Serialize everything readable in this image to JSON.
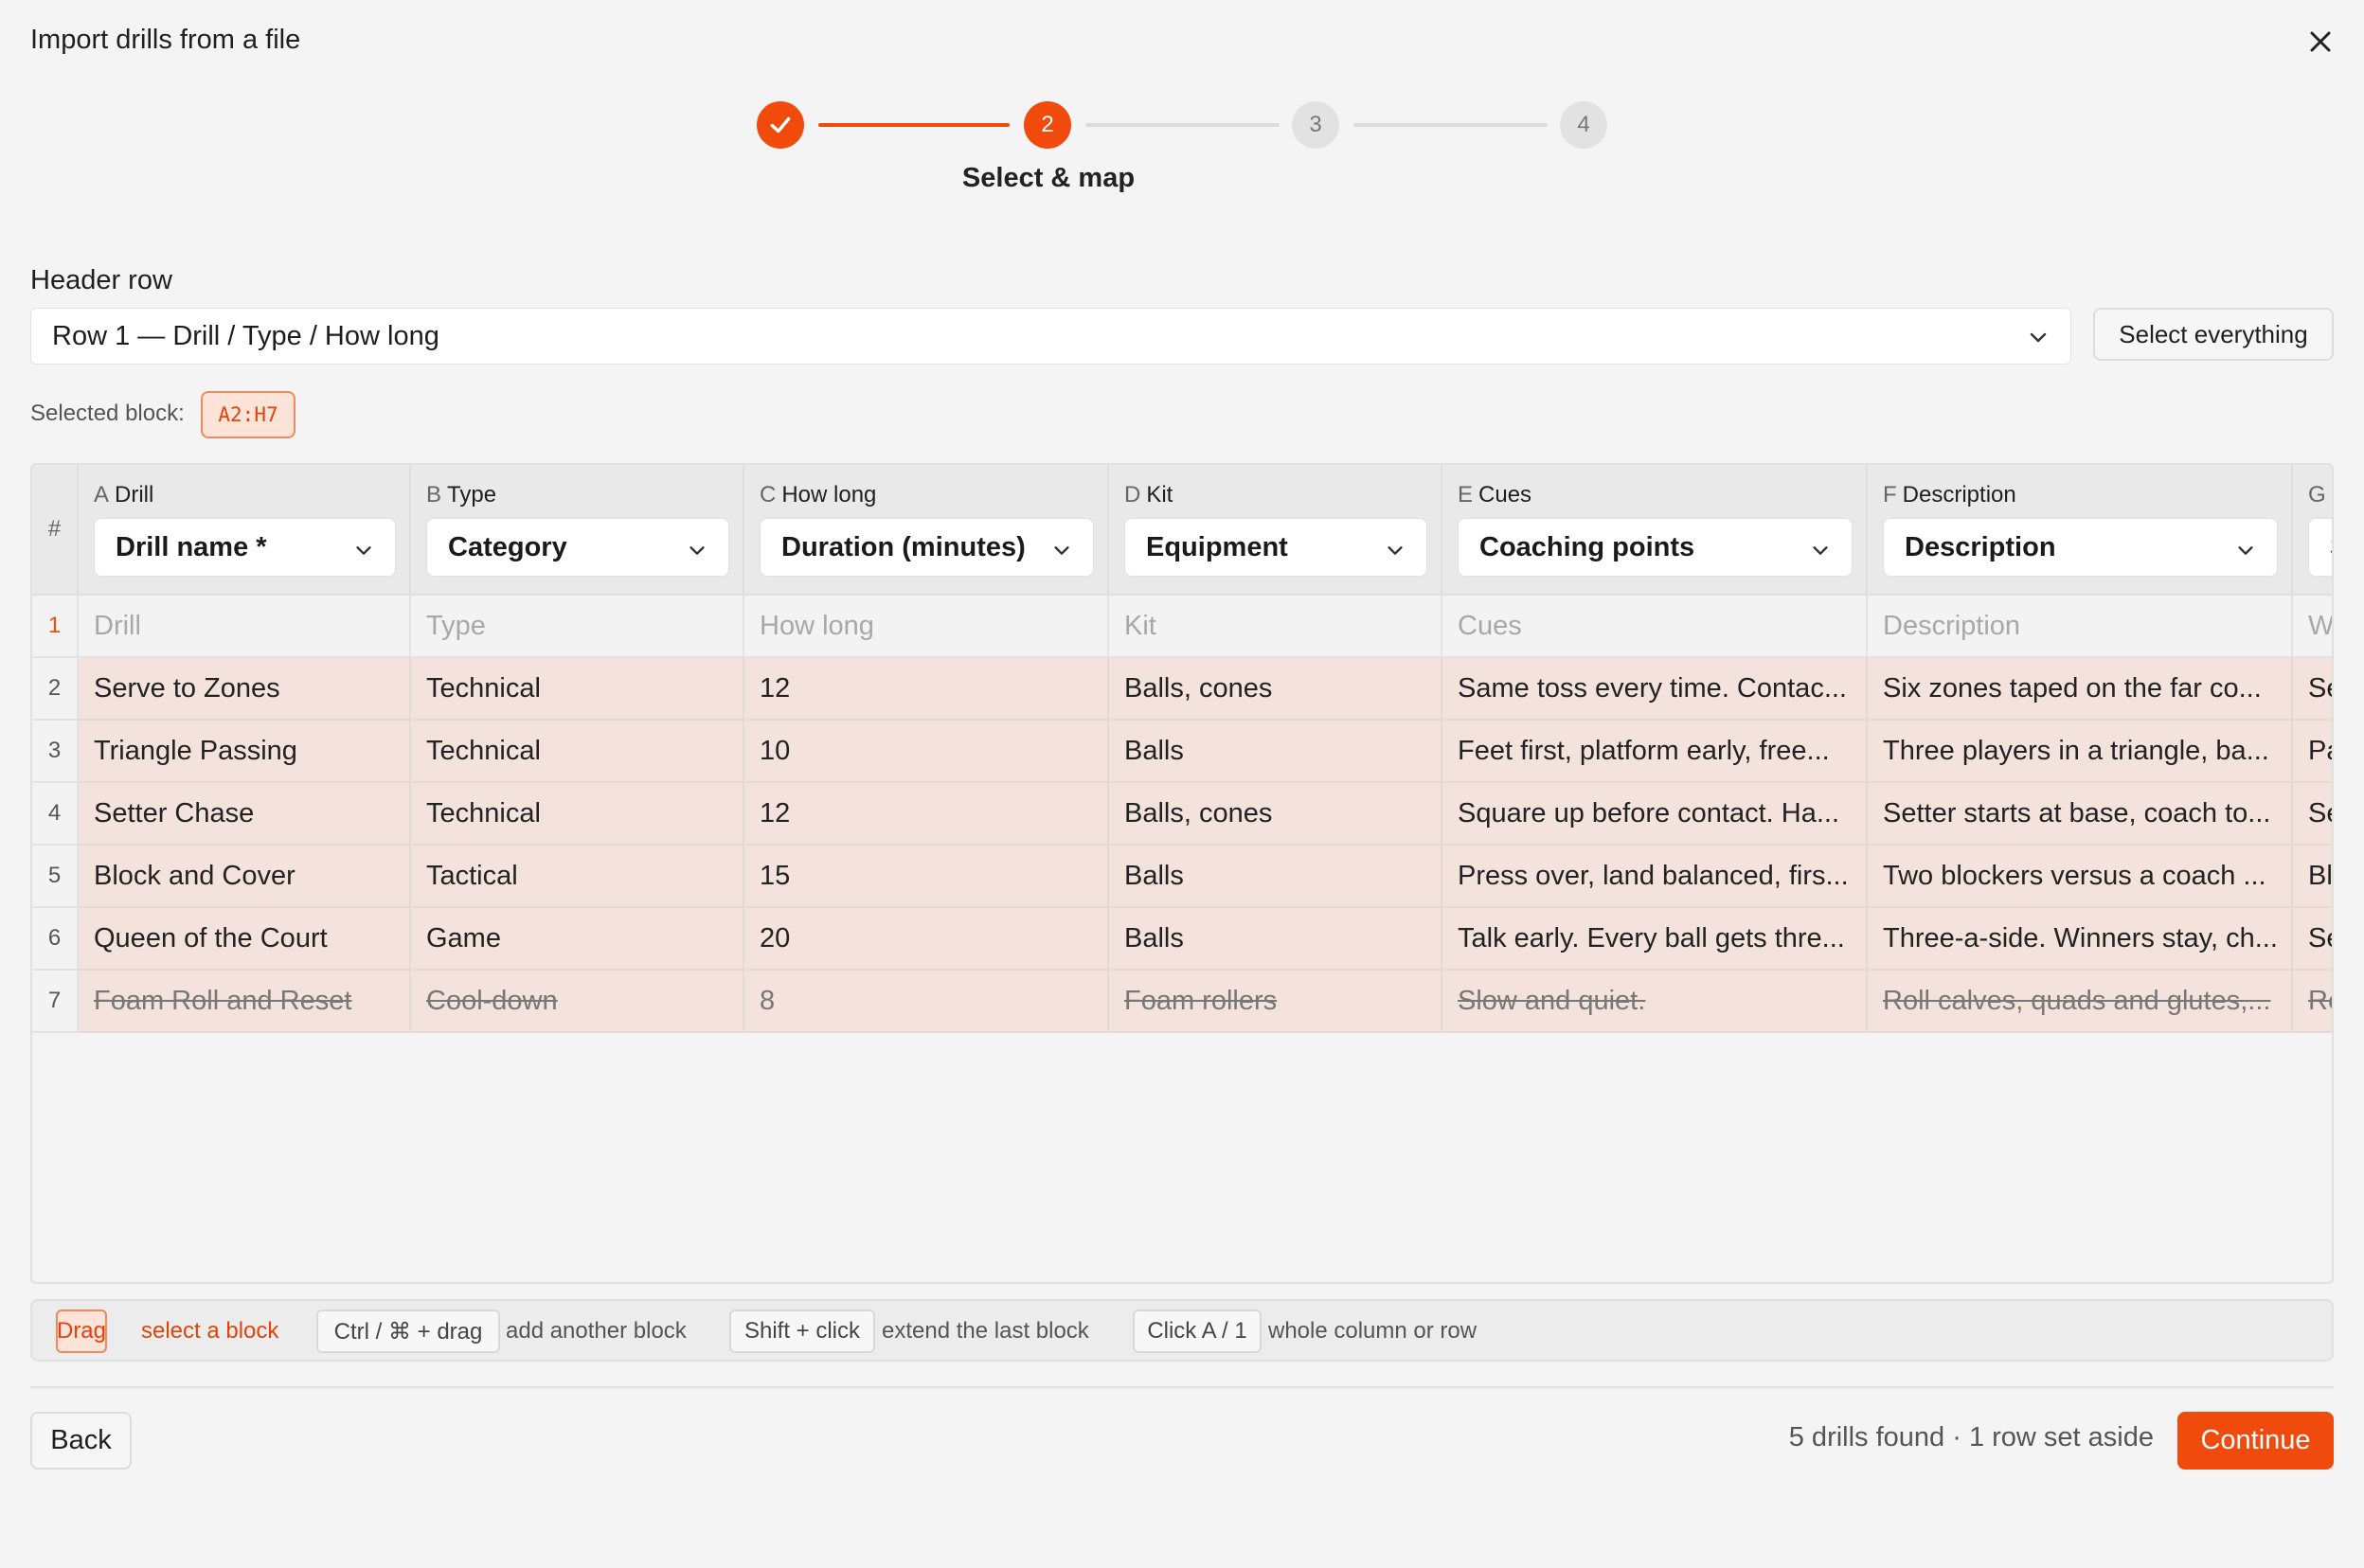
{
  "dialog": {
    "title": "Import drills from a file"
  },
  "stepper": {
    "steps": [
      "",
      "2",
      "3",
      "4"
    ],
    "current_label": "Select & map"
  },
  "header_row": {
    "label": "Header row",
    "value": "Row 1 — Drill / Type / How long",
    "select_all_label": "Select everything"
  },
  "selection": {
    "label": "Selected block:",
    "range": "A2:H7"
  },
  "grid": {
    "hash": "#",
    "columns": [
      {
        "letter": "A",
        "name": "Drill",
        "mapping": "Drill name *"
      },
      {
        "letter": "B",
        "name": "Type",
        "mapping": "Category"
      },
      {
        "letter": "C",
        "name": "How long",
        "mapping": "Duration (minutes)"
      },
      {
        "letter": "D",
        "name": "Kit",
        "mapping": "Equipment"
      },
      {
        "letter": "E",
        "name": "Cues",
        "mapping": "Coaching points"
      },
      {
        "letter": "F",
        "name": "Description",
        "mapping": "Description"
      },
      {
        "letter": "G",
        "name": "",
        "mapping": "S"
      }
    ],
    "rows": [
      {
        "num": "1",
        "cells": [
          "Drill",
          "Type",
          "How long",
          "Kit",
          "Cues",
          "Description",
          "W"
        ]
      },
      {
        "num": "2",
        "cells": [
          "Serve to Zones",
          "Technical",
          "12",
          "Balls, cones",
          "Same toss every time. Contac...",
          "Six zones taped on the far co...",
          "Se"
        ]
      },
      {
        "num": "3",
        "cells": [
          "Triangle Passing",
          "Technical",
          "10",
          "Balls",
          "Feet first, platform early, free...",
          "Three players in a triangle, ba...",
          "Pa"
        ]
      },
      {
        "num": "4",
        "cells": [
          "Setter Chase",
          "Technical",
          "12",
          "Balls, cones",
          "Square up before contact. Ha...",
          "Setter starts at base, coach to...",
          "Se"
        ]
      },
      {
        "num": "5",
        "cells": [
          "Block and Cover",
          "Tactical",
          "15",
          "Balls",
          "Press over, land balanced, firs...",
          "Two blockers versus a coach ...",
          "Bl"
        ]
      },
      {
        "num": "6",
        "cells": [
          "Queen of the Court",
          "Game",
          "20",
          "Balls",
          "Talk early. Every ball gets thre...",
          "Three-a-side. Winners stay, ch...",
          "Se"
        ]
      },
      {
        "num": "7",
        "cells": [
          "Foam Roll and Reset",
          "Cool-down",
          "8",
          "Foam rollers",
          "Slow and quiet.",
          "Roll calves, quads and glutes,...",
          "Re"
        ]
      }
    ]
  },
  "hints": [
    {
      "key": "Drag",
      "text": "select a block"
    },
    {
      "key": "Ctrl / ⌘ + drag",
      "text": "add another block"
    },
    {
      "key": "Shift + click",
      "text": "extend the last block"
    },
    {
      "key": "Click A / 1",
      "text": "whole column or row"
    }
  ],
  "footer": {
    "back_label": "Back",
    "summary": "5 drills found · 1 row set aside",
    "continue_label": "Continue"
  },
  "colors": {
    "accent": "#f04a0c",
    "selected_row": "#f4e2dc",
    "chip_bg": "#fbe3d7"
  }
}
